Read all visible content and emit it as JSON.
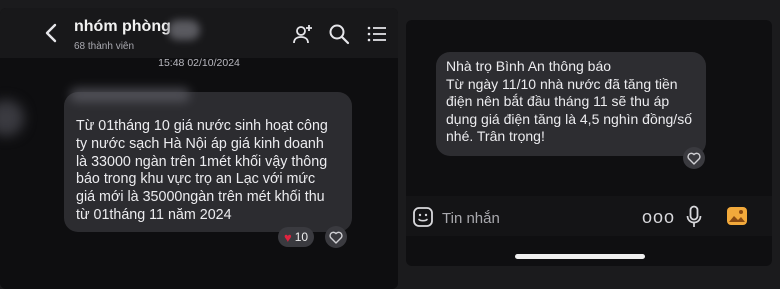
{
  "left_chat": {
    "header": {
      "group_name": "nhóm phòng",
      "member_count": "68 thành viên",
      "icons": [
        "back-arrow-icon",
        "add-member-icon",
        "search-icon",
        "menu-list-icon"
      ]
    },
    "timestamp": "15:48 02/10/2024",
    "message": {
      "text": "Từ 01tháng 10 giá nước sinh hoạt công\nty nước sạch Hà Nội áp giá kinh doanh\nlà 33000 ngàn trên 1mét khối vậy thông\nbáo trong khu vực trọ an Lạc với mức\ngiá mới là 35000ngàn trên mét khối thu\ntừ 01tháng 11 năm 2024",
      "reaction_count": "10",
      "reaction_icon": "heart-icon"
    }
  },
  "right_chat": {
    "message": {
      "text": "Nhà trọ Bình An thông báo\nTừ ngày 11/10 nhà nước đã tăng tiền\nđiện nên bắt đầu tháng 11 sẽ thu áp\ndụng giá điện tăng là 4,5 nghìn đồng/số\nnhé. Trân trọng!"
    },
    "composer": {
      "placeholder": "Tin nhắn",
      "more": "ooo",
      "icons": [
        "emoji-icon",
        "more-icon",
        "microphone-icon",
        "image-icon"
      ]
    }
  },
  "colors": {
    "background": "#1b1b1d",
    "bubble": "#2c2c30",
    "heart": "#e0233f",
    "image_icon": "#f2a93b"
  }
}
